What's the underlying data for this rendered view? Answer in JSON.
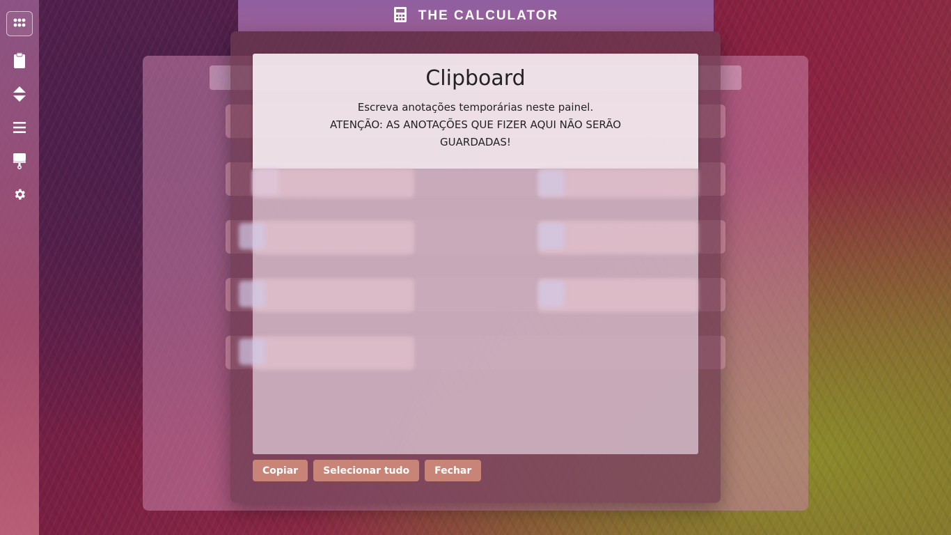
{
  "app": {
    "title": "THE CALCULATOR"
  },
  "sidebar": {
    "items": [
      {
        "name": "apps",
        "icon": "apps-grid-icon"
      },
      {
        "name": "clipboard",
        "icon": "clipboard-icon"
      },
      {
        "name": "sort",
        "icon": "sort-arrows-icon"
      },
      {
        "name": "menu",
        "icon": "menu-icon"
      },
      {
        "name": "theme",
        "icon": "paint-roller-icon"
      },
      {
        "name": "settings",
        "icon": "gear-icon"
      }
    ]
  },
  "search": {
    "icon": "search-icon"
  },
  "modal": {
    "title": "Clipboard",
    "description": "Escreva anotações temporárias neste painel.",
    "warning": "ATENÇÃO: AS ANOTAÇÕES QUE FIZER AQUI NÃO SERÃO GUARDADAS!",
    "textarea_value": "",
    "buttons": {
      "copy": "Copiar",
      "select_all": "Selecionar tudo",
      "close": "Fechar"
    }
  },
  "colors": {
    "header_bg": "#9b5f98",
    "button_bg": "#c98478",
    "modal_head_bg": "#f5ebf0"
  }
}
